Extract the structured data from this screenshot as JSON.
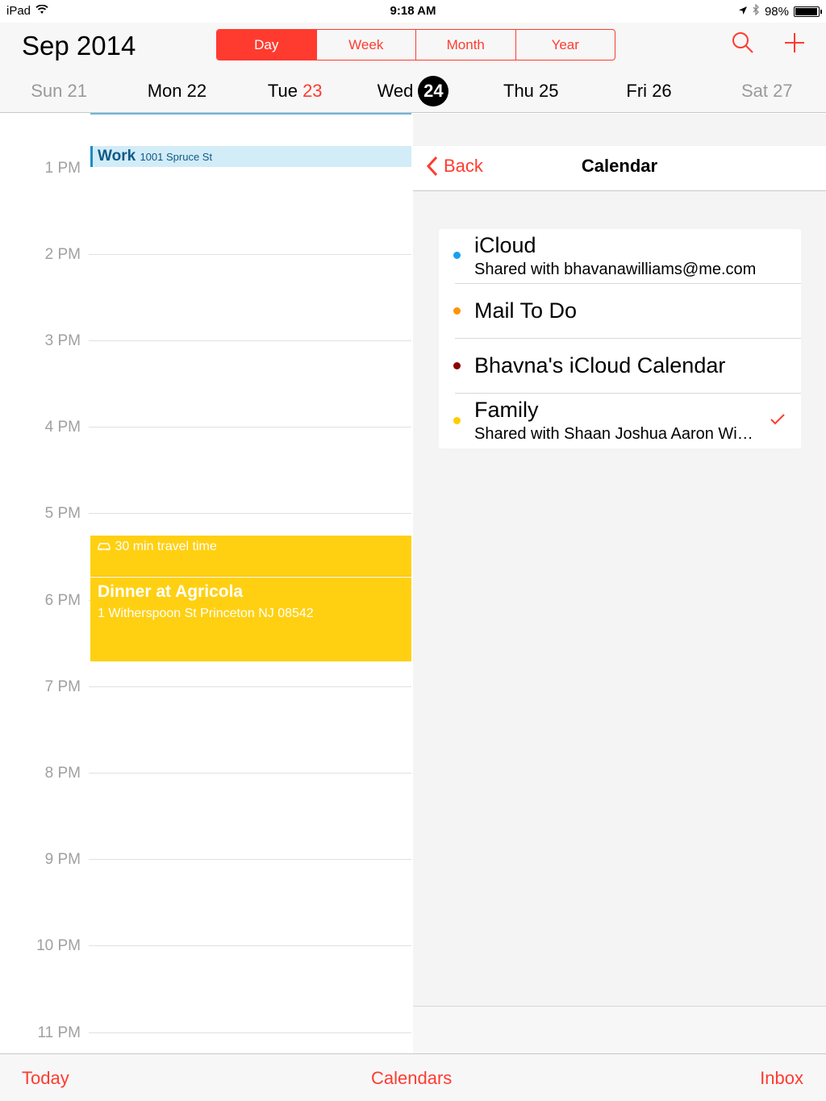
{
  "status": {
    "device": "iPad",
    "time": "9:18 AM",
    "battery": "98%",
    "battery_level": 0.98
  },
  "header": {
    "month": "Sep",
    "year": "2014",
    "segments": [
      "Day",
      "Week",
      "Month",
      "Year"
    ],
    "active_segment": "Day",
    "days": [
      {
        "name": "Sun",
        "num": "21"
      },
      {
        "name": "Mon",
        "num": "22"
      },
      {
        "name": "Tue",
        "num": "23"
      },
      {
        "name": "Wed",
        "num": "24"
      },
      {
        "name": "Thu",
        "num": "25"
      },
      {
        "name": "Fri",
        "num": "26"
      },
      {
        "name": "Sat",
        "num": "27"
      }
    ]
  },
  "timeline": {
    "hours": [
      "1 PM",
      "2 PM",
      "3 PM",
      "4 PM",
      "5 PM",
      "6 PM",
      "7 PM",
      "8 PM",
      "9 PM",
      "10 PM",
      "11 PM"
    ],
    "work_event": {
      "title": "Work",
      "location": "1001 Spruce St"
    },
    "travel": "30 min travel time",
    "dinner": {
      "title": "Dinner at Agricola",
      "address": "1 Witherspoon St Princeton NJ 08542"
    }
  },
  "panel": {
    "back": "Back",
    "title": "Calendar",
    "calendars": [
      {
        "name": "iCloud",
        "sub": "Shared with bhavanawilliams@me.com",
        "color": "#1a9ff0"
      },
      {
        "name": "Mail To Do",
        "sub": "",
        "color": "#ff9500"
      },
      {
        "name": "Bhavna's iCloud Calendar",
        "sub": "",
        "color": "#8b0000"
      },
      {
        "name": "Family",
        "sub": "Shared with Shaan Joshua Aaron Wi…",
        "color": "#ffcc00",
        "checked": true
      }
    ]
  },
  "toolbar": {
    "today": "Today",
    "calendars": "Calendars",
    "inbox": "Inbox"
  },
  "colors": {
    "accent": "#ff3b30",
    "event_yellow": "#ffd012",
    "work_blue": "#d2ecf8"
  }
}
